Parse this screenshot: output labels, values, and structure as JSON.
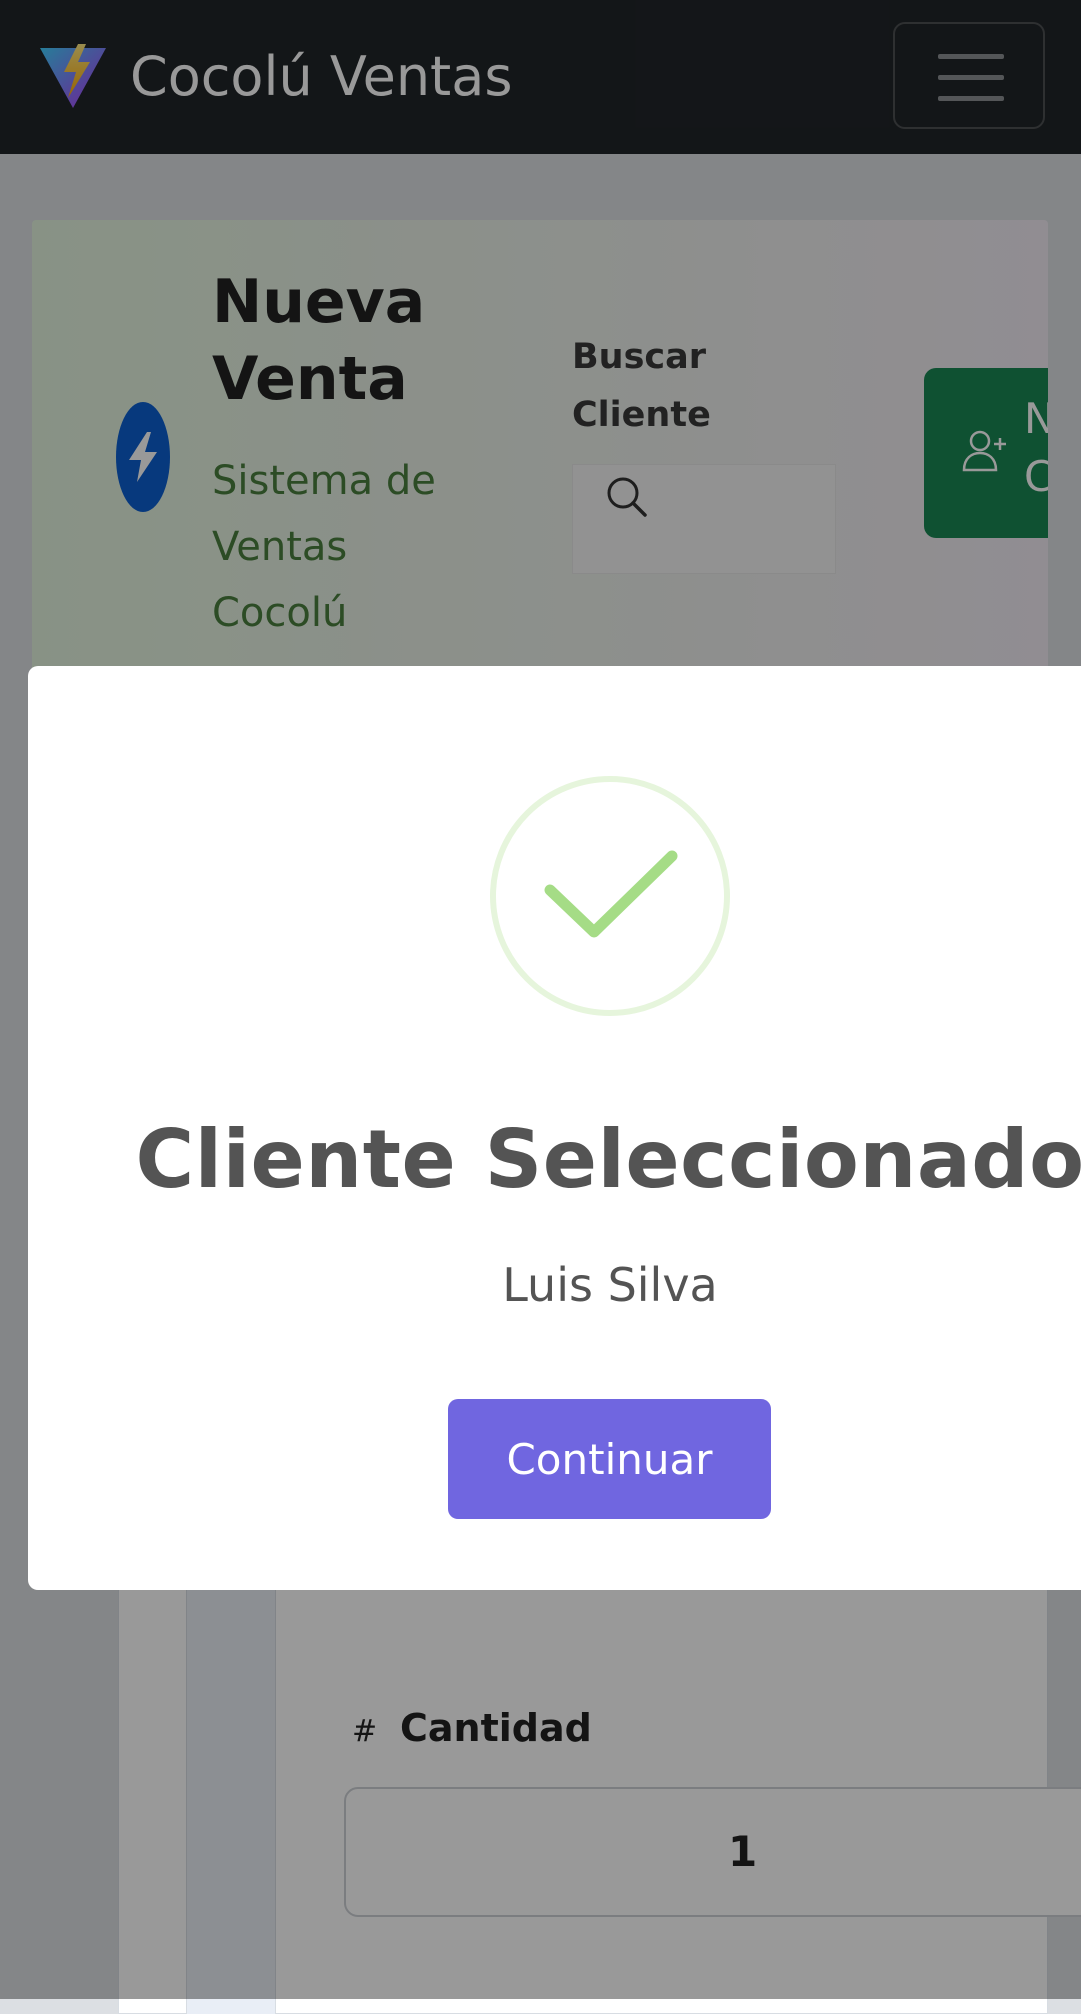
{
  "navbar": {
    "brand": "Cocolú Ventas",
    "logo_icon": "vite-logo-icon",
    "menu_icon": "hamburger-menu-icon"
  },
  "header": {
    "title": "Nueva Venta",
    "subtitle": "Sistema de Ventas Cocolú",
    "logo_icon": "bolt-icon",
    "search": {
      "label": "Buscar Cliente",
      "placeholder": "",
      "icon": "search-icon"
    },
    "new_client_button": {
      "label": "Nuevo Cliente",
      "icon": "user-plus-icon"
    }
  },
  "form": {
    "quantity_hash": "#",
    "quantity_label": "Cantidad",
    "quantity_value": "1"
  },
  "modal": {
    "icon": "success-check-icon",
    "title": "Cliente Seleccionado",
    "text": "Luis Silva",
    "confirm_label": "Continuar"
  },
  "colors": {
    "navbar_bg": "#212529",
    "success_button": "#198754",
    "confirm_button": "#7066e0",
    "check_green": "#a5dc86",
    "subtitle_green": "#4a7f3f"
  }
}
